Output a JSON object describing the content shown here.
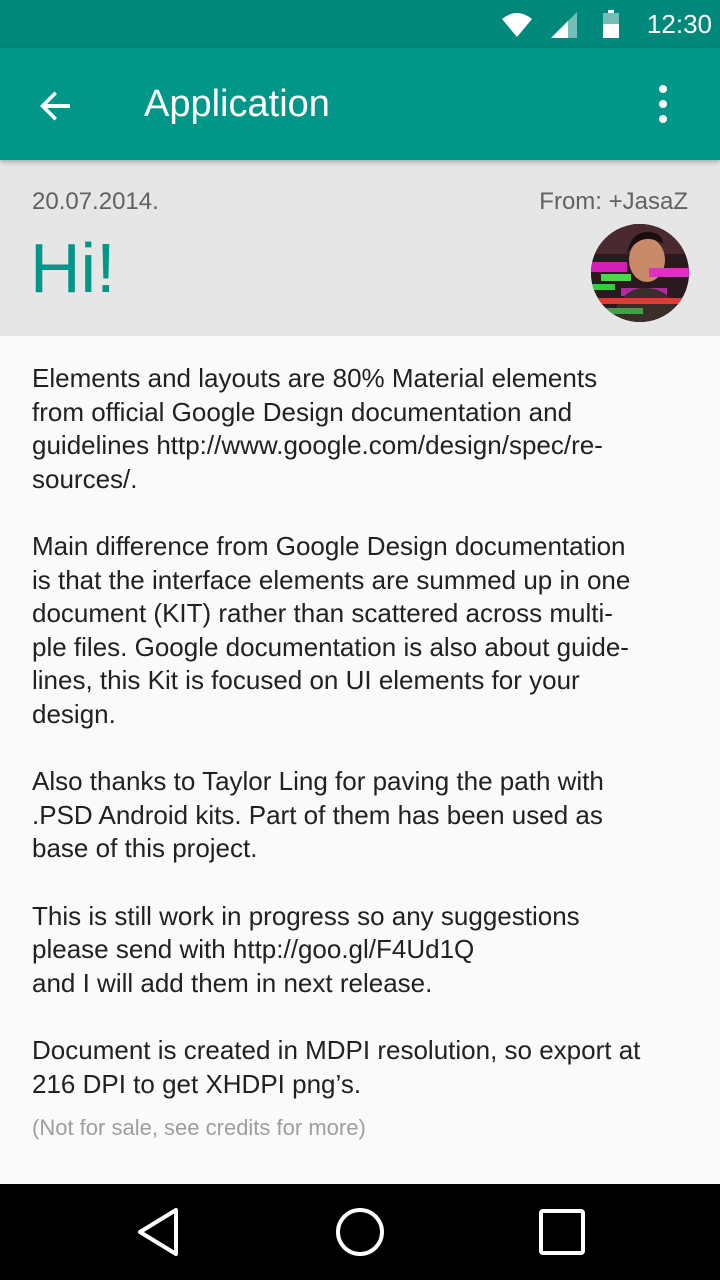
{
  "status_bar": {
    "time": "12:30",
    "icons": [
      "wifi-icon",
      "cellular-signal-icon",
      "battery-icon"
    ]
  },
  "app_bar": {
    "title": "Application",
    "icons": [
      "arrow-back-icon",
      "more-vert-icon"
    ],
    "color": "#009688"
  },
  "header": {
    "date": "20.07.2014.",
    "from": "From: +JasaZ",
    "greeting": "Hi!"
  },
  "body": {
    "paragraphs": [
      [
        "Elements and layouts are 80% Material elements",
        "from official Google Design documentation and",
        "guidelines http://www.google.com/design/spec/re-",
        "sources/."
      ],
      [
        "Main difference from Google Design documentation",
        "is that the interface elements are summed up in one",
        "document (KIT) rather than scattered across multi-",
        "ple files. Google documentation is also about guide-",
        "lines, this Kit is focused on UI elements for your",
        "design."
      ],
      [
        "Also thanks to Taylor Ling for paving the path with",
        ".PSD Android kits. Part of them has been used as",
        "base of this project."
      ],
      [
        "This is still work in progress so any suggestions",
        "please send with http://goo.gl/F4Ud1Q",
        "and I will add them in next release."
      ],
      [
        "Document is created in MDPI resolution, so export at",
        "216 DPI to get XHDPI png’s."
      ]
    ],
    "note": "(Not for sale, see credits for more)"
  },
  "nav_bar": {
    "icons": [
      "nav-back-icon",
      "nav-home-icon",
      "nav-recents-icon"
    ]
  },
  "colors": {
    "status_bar": "#00897b",
    "accent": "#009688",
    "header_bg": "#e6e6e6"
  }
}
